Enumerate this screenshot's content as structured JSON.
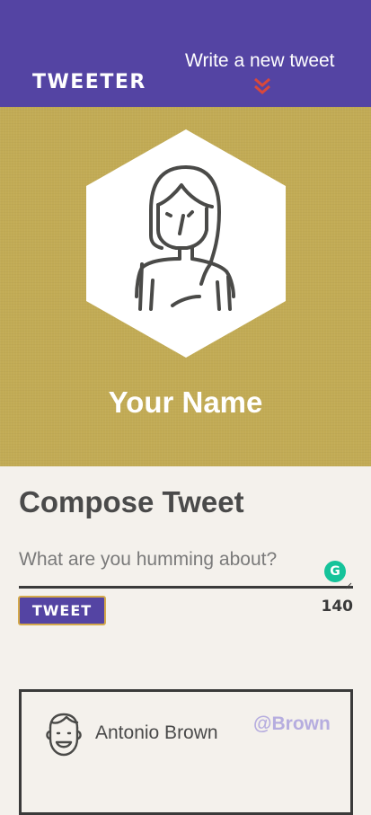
{
  "nav": {
    "brand": "TWEETER",
    "write_link": "Write a new tweet"
  },
  "profile": {
    "name": "Your Name",
    "avatar_icon": "female-user-icon"
  },
  "compose": {
    "title": "Compose Tweet",
    "placeholder": "What are you humming about?",
    "value": "",
    "button_label": "TWEET",
    "counter": "140"
  },
  "tweets": [
    {
      "avatar_icon": "male-user-icon",
      "name": "Antonio Brown",
      "handle": "@Brown"
    }
  ],
  "colors": {
    "nav_bg": "#5444a3",
    "hero_bg": "#c2ab55",
    "page_bg": "#f4f1ec",
    "chevron": "#d9483b",
    "handle": "#b6addf"
  }
}
